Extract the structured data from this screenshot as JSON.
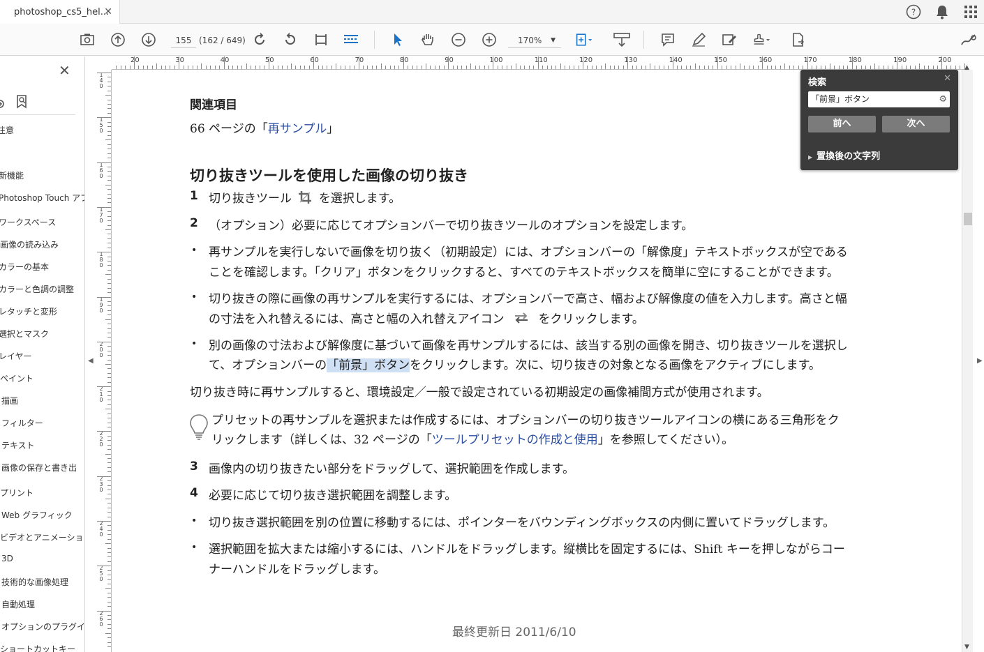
{
  "tab": {
    "title": "photoshop_cs5_hel...",
    "close": "✕"
  },
  "toolbar": {
    "page_current": "155",
    "page_total": "(162 / 649)",
    "zoom": "170%"
  },
  "left_nav": {
    "items": [
      "注意",
      "新機能",
      "Photoshop Touch アプ",
      "ワークスペース",
      "画像の読み込み",
      "カラーの基本",
      "カラーと色調の調整",
      "レタッチと変形",
      "選択とマスク",
      "レイヤー",
      "ペイント",
      "描画",
      "フィルター",
      "テキスト",
      "画像の保存と書き出",
      "プリント",
      "Web グラフィック",
      "ビデオとアニメーション",
      "3D",
      "技術的な画像処理",
      "自動処理",
      "オプションのプラグイン",
      "ショートカットキー"
    ]
  },
  "hruler": {
    "labels": [
      "20",
      "30",
      "40",
      "50",
      "60",
      "70",
      "80",
      "90",
      "100",
      "110",
      "120",
      "130",
      "140",
      "150",
      "160",
      "170",
      "180",
      "190",
      "200"
    ]
  },
  "vruler": {
    "labels": [
      "140",
      "150",
      "160",
      "170",
      "180",
      "190",
      "200",
      "210",
      "220",
      "230",
      "240",
      "250",
      "260"
    ]
  },
  "document": {
    "related_heading": "関連項目",
    "related_line_prefix": "66 ページの「",
    "related_link": "再サンプル",
    "related_line_suffix": "」",
    "section_heading": "切り抜きツールを使用した画像の切り抜き",
    "step1_num": "1",
    "step1_a": "切り抜きツール",
    "step1_b": "を選択します。",
    "step2_num": "2",
    "step2": "（オプション）必要に応じてオプションバーで切り抜きツールのオプションを設定します。",
    "b1_l1": "再サンプルを実行しないで画像を切り抜く（初期設定）には、オプションバーの「解像度」テキストボックスが空である",
    "b1_l2": "ことを確認します。「クリア」ボタンをクリックすると、すべてのテキストボックスを簡単に空にすることができます。",
    "b2_l1": "切り抜きの際に画像の再サンプルを実行するには、オプションバーで高さ、幅および解像度の値を入力します。高さと幅",
    "b2_l2a": "の寸法を入れ替えるには、高さと幅の入れ替えアイコン",
    "b2_l2b": "をクリックします。",
    "b3_l1": "別の画像の寸法および解像度に基づいて画像を再サンプルするには、該当する別の画像を開き、切り抜きツールを選択し",
    "b3_l2a": "て、オプションバーの",
    "b3_l2_hl": "「前景」ボタン",
    "b3_l2b": "をクリックします。次に、切り抜きの対象となる画像をアクティブにします。",
    "para": "切り抜き時に再サンプルすると、環境設定／一般で設定されている初期設定の画像補間方式が使用されます。",
    "tip_l1": "プリセットの再サンプルを選択または作成するには、オプションバーの切り抜きツールアイコンの横にある三角形をク",
    "tip_l2a": "リックします（詳しくは、32 ページの「",
    "tip_link": "ツールプリセットの作成と使用",
    "tip_l2b": "」を参照してください）。",
    "step3_num": "3",
    "step3": "画像内の切り抜きたい部分をドラッグして、選択範囲を作成します。",
    "step4_num": "4",
    "step4": "必要に応じて切り抜き選択範囲を調整します。",
    "b4": "切り抜き選択範囲を別の位置に移動するには、ポインターをバウンディングボックスの内側に置いてドラッグします。",
    "b5_l1": "選択範囲を拡大または縮小するには、ハンドルをドラッグします。縦横比を固定するには、Shift キーを押しながらコー",
    "b5_l2": "ナーハンドルをドラッグします。",
    "bullet": "•",
    "footer": "最終更新日 2011/6/10"
  },
  "search_panel": {
    "title": "検索",
    "close": "✕",
    "query": "「前景」ボタン",
    "prev_label": "前へ",
    "next_label": "次へ",
    "replace_label": "置換後の文字列"
  },
  "colors": {
    "link": "#2b4ea3",
    "highlight": "#cfe0f5",
    "panel_bg": "#3b3b3b",
    "accent_blue": "#1a73c7"
  }
}
